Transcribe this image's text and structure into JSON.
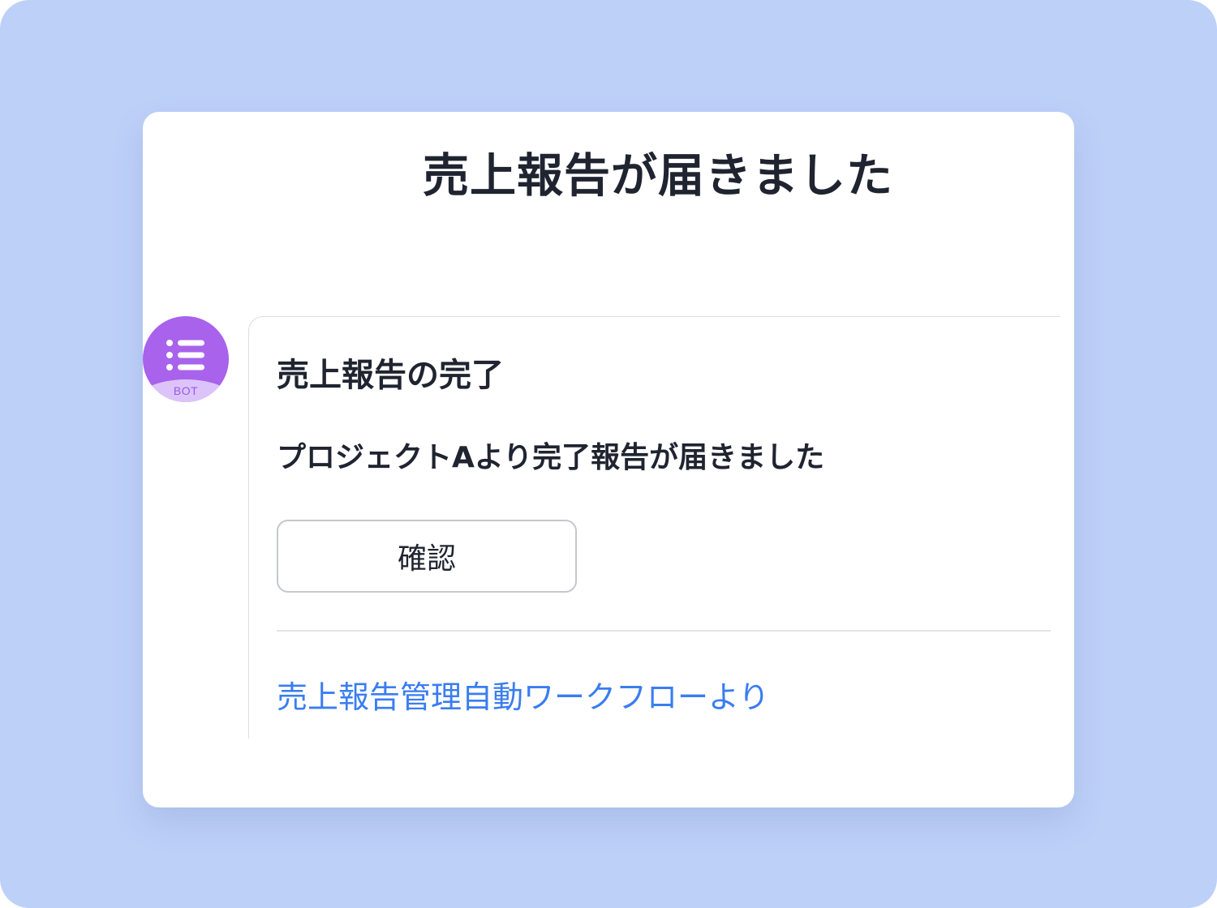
{
  "page": {
    "title": "売上報告が届きました"
  },
  "bot": {
    "badge_label": "BOT",
    "avatar_icon": "list-icon",
    "avatar_color": "#a862ec"
  },
  "message": {
    "heading": "売上報告の完了",
    "body": "プロジェクトAより完了報告が届きました",
    "confirm_label": "確認",
    "footer_link": "売上報告管理自動ワークフローより"
  },
  "colors": {
    "background": "#bdd0f8",
    "card": "#ffffff",
    "text": "#1f2430",
    "link": "#3a7df0"
  }
}
